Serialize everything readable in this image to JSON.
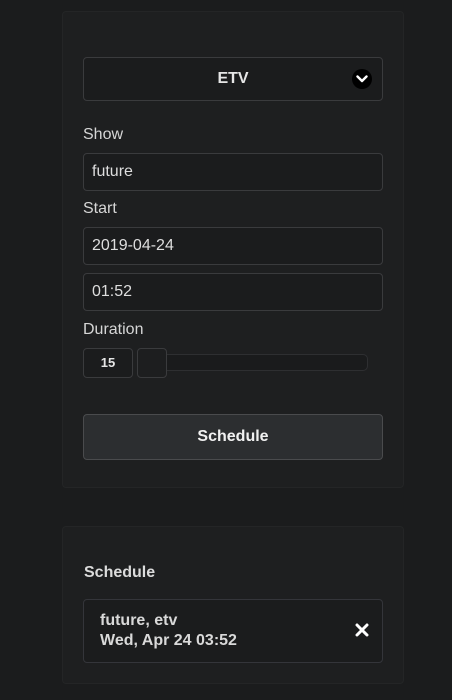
{
  "station": {
    "selected": "ETV",
    "icon": "chevron-down-icon"
  },
  "form": {
    "show_label": "Show",
    "show_value": "future",
    "start_label": "Start",
    "start_date": "2019-04-24",
    "start_time": "01:52",
    "duration_label": "Duration",
    "duration_value": "15",
    "duration_slider_fraction": 0,
    "schedule_button": "Schedule"
  },
  "schedule": {
    "title": "Schedule",
    "items": [
      {
        "line1": "future, etv",
        "line2": "Wed, Apr 24 03:52",
        "remove_icon": "close-icon"
      }
    ]
  }
}
